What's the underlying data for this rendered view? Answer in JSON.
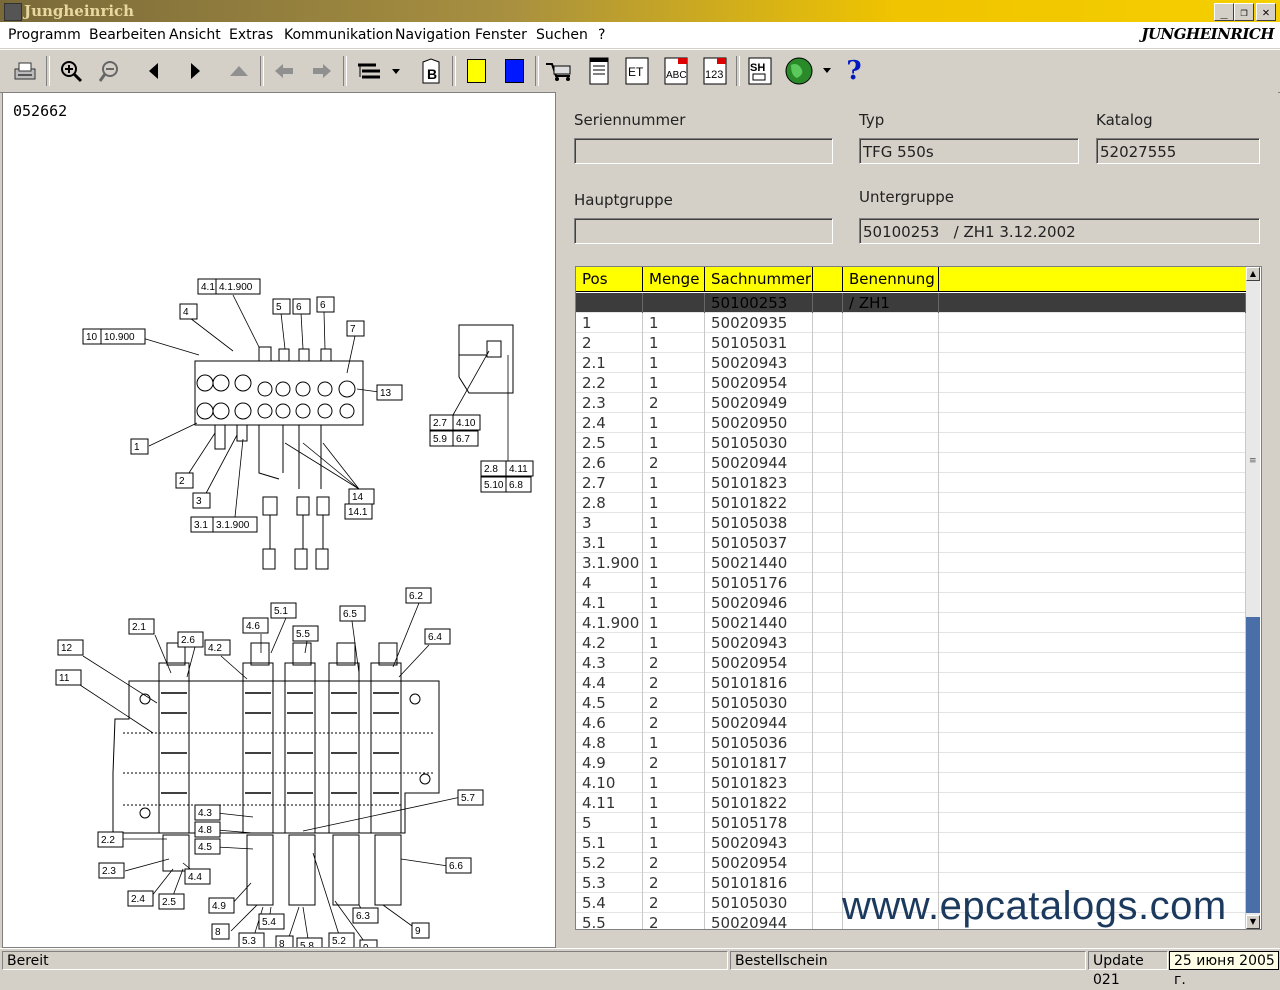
{
  "window": {
    "title": "Jungheinrich",
    "brand": "JUNGHEINRICH"
  },
  "menu": [
    "Programm",
    "Bearbeiten",
    "Ansicht",
    "Extras",
    "Kommunikation",
    "Navigation",
    "Fenster",
    "Suchen",
    "?"
  ],
  "toolbar": {
    "icons": [
      "print-icon",
      "zoom-in-icon",
      "zoom-out-icon",
      "previous-icon",
      "next-icon",
      "up-icon",
      "back-arrow-icon",
      "forward-arrow-icon",
      "tree-view-icon",
      "bookmark-icon",
      "yellow-color-icon",
      "blue-color-icon",
      "order-icon",
      "sheet-icon",
      "et-icon",
      "abc-icon",
      "123-icon",
      "sh-icon",
      "globe-icon",
      "help-icon"
    ],
    "labels": {
      "bookmark": "B",
      "et": "ET",
      "abc": "ABC",
      "num": "123",
      "sh": "SH",
      "help": "?"
    }
  },
  "drawing": {
    "number": "052662"
  },
  "form": {
    "serial_label": "Seriennummer",
    "serial_value": "",
    "type_label": "Typ",
    "type_value": "TFG 550s",
    "catalog_label": "Katalog",
    "catalog_value": "52027555",
    "main_group_label": "Hauptgruppe",
    "main_group_value": "",
    "sub_group_label": "Untergruppe",
    "sub_group_value": "50100253   / ZH1 3.12.2002"
  },
  "table": {
    "headers": [
      "Pos",
      "Menge",
      "Sachnummer",
      "",
      "Benennung"
    ],
    "rows": [
      [
        "",
        "",
        "50100253",
        "",
        "/ ZH1"
      ],
      [
        "1",
        "1",
        "50020935",
        "",
        ""
      ],
      [
        "2",
        "1",
        "50105031",
        "",
        ""
      ],
      [
        "2.1",
        "1",
        "50020943",
        "",
        ""
      ],
      [
        "2.2",
        "1",
        "50020954",
        "",
        ""
      ],
      [
        "2.3",
        "2",
        "50020949",
        "",
        ""
      ],
      [
        "2.4",
        "1",
        "50020950",
        "",
        ""
      ],
      [
        "2.5",
        "1",
        "50105030",
        "",
        ""
      ],
      [
        "2.6",
        "2",
        "50020944",
        "",
        ""
      ],
      [
        "2.7",
        "1",
        "50101823",
        "",
        ""
      ],
      [
        "2.8",
        "1",
        "50101822",
        "",
        ""
      ],
      [
        "3",
        "1",
        "50105038",
        "",
        ""
      ],
      [
        "3.1",
        "1",
        "50105037",
        "",
        ""
      ],
      [
        "3.1.900",
        "1",
        "50021440",
        "",
        ""
      ],
      [
        "4",
        "1",
        "50105176",
        "",
        ""
      ],
      [
        "4.1",
        "1",
        "50020946",
        "",
        ""
      ],
      [
        "4.1.900",
        "1",
        "50021440",
        "",
        ""
      ],
      [
        "4.2",
        "1",
        "50020943",
        "",
        ""
      ],
      [
        "4.3",
        "2",
        "50020954",
        "",
        ""
      ],
      [
        "4.4",
        "2",
        "50101816",
        "",
        ""
      ],
      [
        "4.5",
        "2",
        "50105030",
        "",
        ""
      ],
      [
        "4.6",
        "2",
        "50020944",
        "",
        ""
      ],
      [
        "4.8",
        "1",
        "50105036",
        "",
        ""
      ],
      [
        "4.9",
        "2",
        "50101817",
        "",
        ""
      ],
      [
        "4.10",
        "1",
        "50101823",
        "",
        ""
      ],
      [
        "4.11",
        "1",
        "50101822",
        "",
        ""
      ],
      [
        "5",
        "1",
        "50105178",
        "",
        ""
      ],
      [
        "5.1",
        "1",
        "50020943",
        "",
        ""
      ],
      [
        "5.2",
        "2",
        "50020954",
        "",
        ""
      ],
      [
        "5.3",
        "2",
        "50101816",
        "",
        ""
      ],
      [
        "5.4",
        "2",
        "50105030",
        "",
        ""
      ],
      [
        "5.5",
        "2",
        "50020944",
        "",
        ""
      ]
    ]
  },
  "watermark": "www.epcatalogs.com",
  "status": {
    "left": "Bereit",
    "middle": "Bestellschein",
    "update": "Update 021",
    "date": "25 июня 2005 г."
  },
  "colors": {
    "header_yellow": "#ffff00",
    "selected_row": "#3c3c3c",
    "scroll_thumb": "#4a6ea8"
  }
}
